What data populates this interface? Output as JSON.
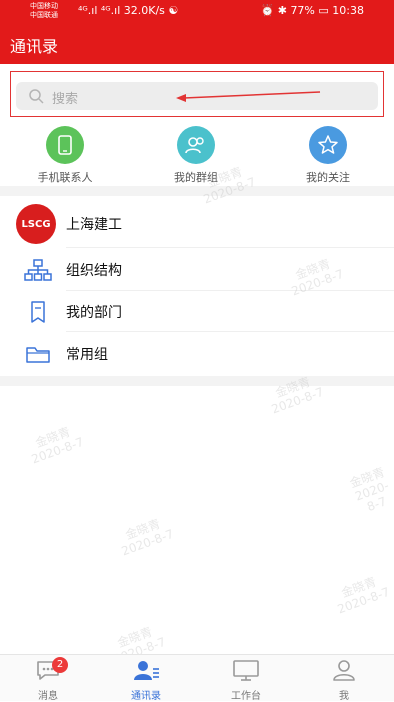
{
  "status_bar": {
    "carrier1": "中国移动",
    "carrier2": "中国联通",
    "speed": "32.0K/s",
    "battery": "77%",
    "time": "10:38"
  },
  "app_bar": {
    "title": "通讯录"
  },
  "search": {
    "placeholder": "搜索"
  },
  "quick_actions": [
    {
      "label": "手机联系人",
      "icon": "phone-icon",
      "color": "#5cc35a"
    },
    {
      "label": "我的群组",
      "icon": "group-icon",
      "color": "#4bc1cc"
    },
    {
      "label": "我的关注",
      "icon": "star-icon",
      "color": "#4a9ae0"
    }
  ],
  "org": {
    "logo_text": "LSCG",
    "name": "上海建工"
  },
  "list": [
    {
      "label": "组织结构",
      "icon": "org-chart-icon"
    },
    {
      "label": "我的部门",
      "icon": "bookmark-icon"
    },
    {
      "label": "常用组",
      "icon": "folder-icon"
    }
  ],
  "watermark": {
    "name": "金晓青",
    "date": "2020-8-7"
  },
  "tabs": [
    {
      "label": "消息",
      "icon": "message-icon",
      "badge": "2"
    },
    {
      "label": "通讯录",
      "icon": "contacts-icon",
      "active": true
    },
    {
      "label": "工作台",
      "icon": "workbench-icon"
    },
    {
      "label": "我",
      "icon": "profile-icon"
    }
  ],
  "colors": {
    "brand_red": "#e21a1a",
    "accent_blue": "#3a73d8"
  }
}
